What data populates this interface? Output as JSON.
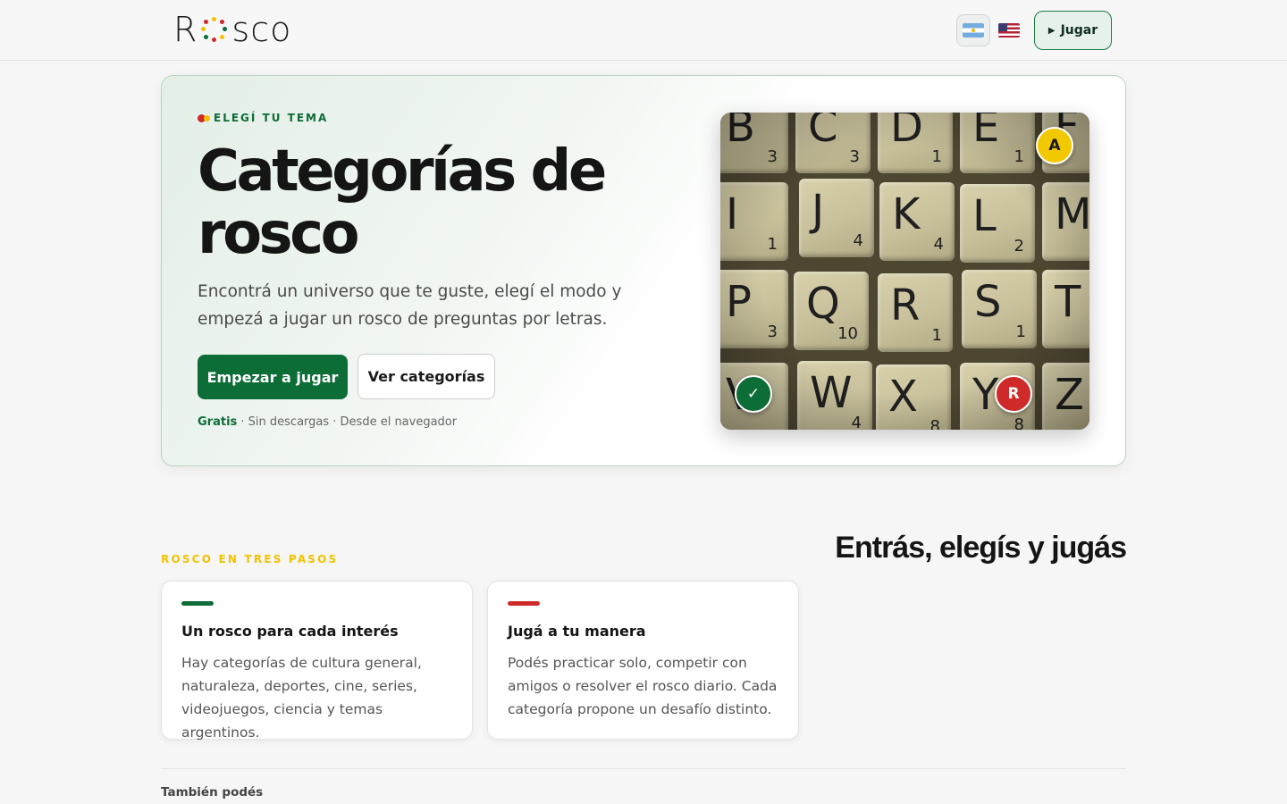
{
  "header": {
    "logo_left": "R",
    "logo_right": "SCO",
    "logo_alt": "Rosco",
    "play_label": "Jugar"
  },
  "hero": {
    "eyebrow": "ELEGÍ TU TEMA",
    "title": "Categorías de rosco",
    "subtitle": "Encontrá un universo que te guste, elegí el modo y empezá a jugar un rosco de preguntas por letras.",
    "primary_cta": "Empezar a jugar",
    "secondary_cta": "Ver categorías",
    "meta_free": "Gratis",
    "meta_rest": " · Sin descargas · Desde el navegador",
    "image_badges": {
      "a": "A",
      "check": "✓",
      "r": "R"
    },
    "tiles": [
      {
        "letter": "B",
        "points": "3"
      },
      {
        "letter": "C",
        "points": "3"
      },
      {
        "letter": "D",
        "points": "1"
      },
      {
        "letter": "E",
        "points": "1"
      },
      {
        "letter": "F",
        "points": ""
      },
      {
        "letter": "I",
        "points": "1"
      },
      {
        "letter": "J",
        "points": "4"
      },
      {
        "letter": "K",
        "points": "4"
      },
      {
        "letter": "L",
        "points": "2"
      },
      {
        "letter": "M",
        "points": ""
      },
      {
        "letter": "P",
        "points": "3"
      },
      {
        "letter": "Q",
        "points": "10"
      },
      {
        "letter": "R",
        "points": "1"
      },
      {
        "letter": "S",
        "points": "1"
      },
      {
        "letter": "T",
        "points": ""
      },
      {
        "letter": "V",
        "points": ""
      },
      {
        "letter": "W",
        "points": "4"
      },
      {
        "letter": "X",
        "points": "8"
      },
      {
        "letter": "Y",
        "points": "8"
      },
      {
        "letter": "Z",
        "points": ""
      }
    ]
  },
  "steps": {
    "eyebrow": "ROSCO EN TRES PASOS",
    "heading": "Entrás, elegís y jugás",
    "cards": [
      {
        "title": "Un rosco para cada interés",
        "text": "Hay categorías de cultura general, naturaleza, deportes, cine, series, videojuegos, ciencia y temas argentinos.",
        "accent": "#0c6d37"
      },
      {
        "title": "Jugá a tu manera",
        "text": "Podés practicar solo, competir con amigos o resolver el rosco diario. Cada categoría propone un desafío distinto.",
        "accent": "#cf2a2a"
      }
    ]
  },
  "footer": {
    "also_label": "También podés"
  },
  "colors": {
    "brand_green": "#0c6d37",
    "brand_red": "#cf2a2a",
    "brand_yellow": "#f2c200"
  }
}
